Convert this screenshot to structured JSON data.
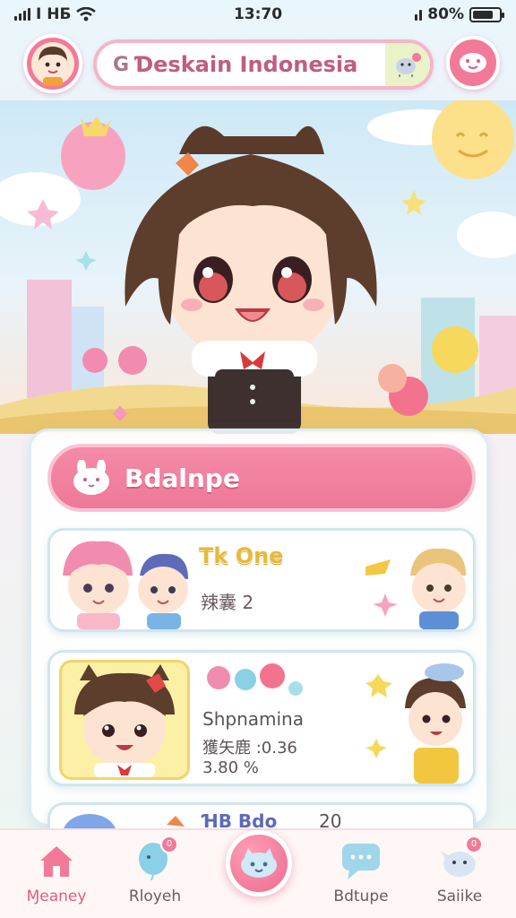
{
  "status_bar": {
    "network": "I НБ",
    "time": "13:70",
    "battery": "80%",
    "battery_level": 0.8
  },
  "search": {
    "glyph": "G",
    "value": "Ɗeskain Indonesia"
  },
  "featured": {
    "title": "Bdalnpe"
  },
  "cards": [
    {
      "title": "Tk One",
      "subtitle": "辣囊 2"
    },
    {
      "title": "Shpnamina",
      "line1": "獲矢鹿 :0.36",
      "line2": "3.80 %"
    },
    {
      "title": "ꞪB Bdo",
      "value": "20"
    }
  ],
  "nav": {
    "items": [
      {
        "label": "Ɱeaney",
        "icon": "home-icon"
      },
      {
        "label": "Rloyeh",
        "icon": "balloon-icon",
        "badge": "0"
      },
      {
        "label": "Bdtupe",
        "icon": "chat-bubble-icon"
      },
      {
        "label": "Saiike",
        "icon": "bird-icon",
        "badge": "0"
      }
    ],
    "center_icon": "cat-face-icon"
  },
  "colors": {
    "accent": "#f27a98",
    "title_gold": "#e7b93a",
    "panel_border": "#cfe6ef"
  }
}
